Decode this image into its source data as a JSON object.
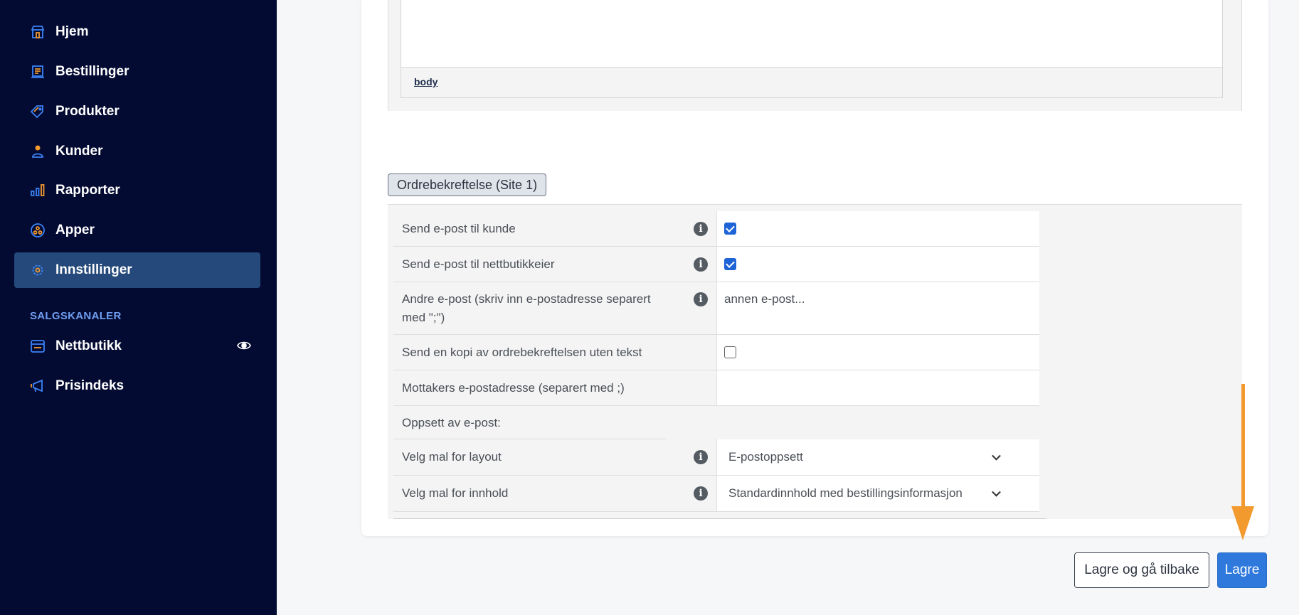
{
  "sidebar": {
    "items": [
      {
        "label": "Hjem",
        "icon": "store-icon"
      },
      {
        "label": "Bestillinger",
        "icon": "orders-icon"
      },
      {
        "label": "Produkter",
        "icon": "tag-icon"
      },
      {
        "label": "Kunder",
        "icon": "person-icon"
      },
      {
        "label": "Rapporter",
        "icon": "bar-chart-icon"
      },
      {
        "label": "Apper",
        "icon": "apps-icon"
      },
      {
        "label": "Innstillinger",
        "icon": "gear-icon",
        "active": true
      }
    ],
    "section_label": "SALGSKANALER",
    "channels": [
      {
        "label": "Nettbutikk",
        "icon": "shop-window-icon"
      },
      {
        "label": "Prisindeks",
        "icon": "megaphone-icon"
      }
    ]
  },
  "editor": {
    "status_path": "body"
  },
  "section": {
    "legend": "Ordrebekreftelse (Site 1)"
  },
  "settings": {
    "send_customer": {
      "label": "Send e-post til kunde",
      "checked": true
    },
    "send_owner": {
      "label": "Send e-post til nettbutikkeier",
      "checked": true
    },
    "other_emails": {
      "label": "Andre e-post (skriv inn e-postadresse separert med \";\")",
      "placeholder": "annen e-post..."
    },
    "send_copy": {
      "label": "Send en kopi av ordrebekreftelsen uten tekst",
      "checked": false
    },
    "recipient": {
      "label": "Mottakers e-postadresse (separert med ;)",
      "value": ""
    },
    "setup_heading": "Oppsett av e-post:",
    "layout_template": {
      "label": "Velg mal for layout",
      "value": "E-postoppsett"
    },
    "content_template": {
      "label": "Velg mal for innhold",
      "value": "Standardinnhold med bestillingsinformasjon"
    }
  },
  "actions": {
    "save_back": "Lagre og gå tilbake",
    "save": "Lagre"
  },
  "colors": {
    "sidebar_bg": "#040b32",
    "active_bg": "#24497a",
    "accent_orange": "#f39a2f",
    "primary": "#2f79dd"
  }
}
